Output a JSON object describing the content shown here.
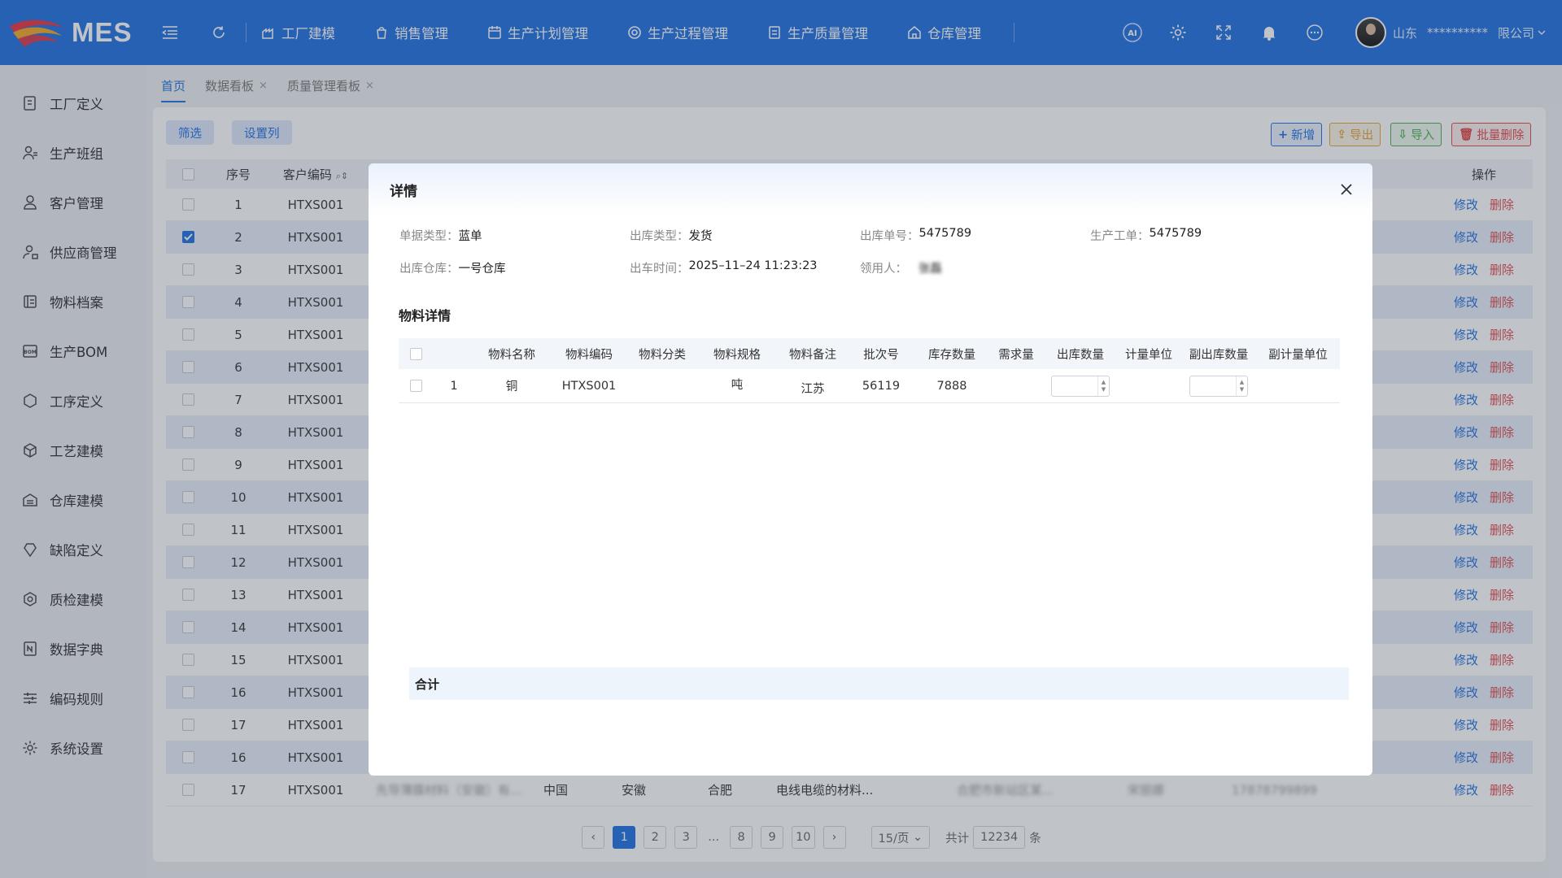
{
  "app": {
    "title": "MES"
  },
  "nav": [
    {
      "label": "工厂建模",
      "icon": "factory-icon"
    },
    {
      "label": "销售管理",
      "icon": "sales-icon"
    },
    {
      "label": "生产计划管理",
      "icon": "calendar-icon"
    },
    {
      "label": "生产过程管理",
      "icon": "process-icon"
    },
    {
      "label": "生产质量管理",
      "icon": "quality-icon"
    },
    {
      "label": "仓库管理",
      "icon": "warehouse-icon"
    }
  ],
  "user": {
    "region": "山东",
    "name_masked": "**********",
    "company": "限公司"
  },
  "sidebar": [
    {
      "label": "工厂定义",
      "icon": "factory-doc-icon"
    },
    {
      "label": "生产班组",
      "icon": "team-icon"
    },
    {
      "label": "客户管理",
      "icon": "customer-icon"
    },
    {
      "label": "供应商管理",
      "icon": "supplier-icon"
    },
    {
      "label": "物料档案",
      "icon": "material-icon"
    },
    {
      "label": "生产BOM",
      "icon": "bom-icon"
    },
    {
      "label": "工序定义",
      "icon": "process-def-icon"
    },
    {
      "label": "工艺建模",
      "icon": "craft-icon"
    },
    {
      "label": "仓库建模",
      "icon": "warehouse-model-icon"
    },
    {
      "label": "缺陷定义",
      "icon": "defect-icon"
    },
    {
      "label": "质检建模",
      "icon": "inspection-icon"
    },
    {
      "label": "数据字典",
      "icon": "dictionary-icon"
    },
    {
      "label": "编码规则",
      "icon": "coding-rules-icon"
    },
    {
      "label": "系统设置",
      "icon": "settings-icon"
    }
  ],
  "tabs": [
    {
      "label": "首页",
      "active": true,
      "closable": false
    },
    {
      "label": "数据看板",
      "active": false,
      "closable": true
    },
    {
      "label": "质量管理看板",
      "active": false,
      "closable": true
    }
  ],
  "toolbar": {
    "filter": "筛选",
    "columns": "设置列",
    "add": "新增",
    "export": "导出",
    "import": "导入",
    "batch_delete": "批量删除"
  },
  "table": {
    "headers": {
      "no": "序号",
      "code": "客户编码",
      "op": "操作"
    },
    "edit": "修改",
    "delete": "删除",
    "rows": [
      {
        "no": "1",
        "code": "HTXS001"
      },
      {
        "no": "2",
        "code": "HTXS001",
        "checked": true
      },
      {
        "no": "3",
        "code": "HTXS001"
      },
      {
        "no": "4",
        "code": "HTXS001"
      },
      {
        "no": "5",
        "code": "HTXS001"
      },
      {
        "no": "6",
        "code": "HTXS001"
      },
      {
        "no": "7",
        "code": "HTXS001"
      },
      {
        "no": "8",
        "code": "HTXS001"
      },
      {
        "no": "9",
        "code": "HTXS001"
      },
      {
        "no": "10",
        "code": "HTXS001"
      },
      {
        "no": "11",
        "code": "HTXS001"
      },
      {
        "no": "12",
        "code": "HTXS001"
      },
      {
        "no": "13",
        "code": "HTXS001"
      },
      {
        "no": "14",
        "code": "HTXS001"
      },
      {
        "no": "15",
        "code": "HTXS001"
      },
      {
        "no": "16",
        "code": "HTXS001"
      },
      {
        "no": "17",
        "code": "HTXS001"
      },
      {
        "no": "16",
        "code": "HTXS001"
      },
      {
        "no": "17",
        "code": "HTXS001",
        "name": "先导薄膜材料（安徽）有...",
        "country": "中国",
        "province": "安徽",
        "city": "合肥",
        "desc": "电线电缆的材料...",
        "address": "合肥市新站区某...",
        "contact": "宋丽娜",
        "phone": "17878799899"
      }
    ]
  },
  "pager": {
    "pages": [
      "1",
      "2",
      "3",
      "...",
      "8",
      "9",
      "10"
    ],
    "current": "1",
    "page_size": "15/页",
    "total_label": "共计",
    "total": "12234",
    "unit": "条"
  },
  "modal": {
    "title": "详情",
    "info": [
      {
        "label": "单据类型：",
        "value": "蓝单"
      },
      {
        "label": "出库类型：",
        "value": "发货"
      },
      {
        "label": "出库单号：",
        "value": "5475789"
      },
      {
        "label": "生产工单：",
        "value": "5475789"
      },
      {
        "label": "出库仓库：",
        "value": "一号仓库"
      },
      {
        "label": "出车时间：",
        "value": "2025–11–24 11:23:23"
      },
      {
        "label": "领用人：",
        "value": "张磊"
      }
    ],
    "section_title": "物料详情",
    "headers": [
      "物料名称",
      "物料编码",
      "物料分类",
      "物料规格",
      "物料备注",
      "批次号",
      "库存数量",
      "需求量",
      "出库数量",
      "计量单位",
      "副出库数量",
      "副计量单位"
    ],
    "row": {
      "no": "1",
      "name": "铜",
      "code": "HTXS001",
      "category": "",
      "spec": "吨",
      "remark": "江苏",
      "batch": "56119",
      "stock": "7888",
      "demand": "",
      "out_qty": "",
      "unit": "",
      "sub_qty": "",
      "sub_unit": ""
    },
    "total_label": "合计"
  }
}
